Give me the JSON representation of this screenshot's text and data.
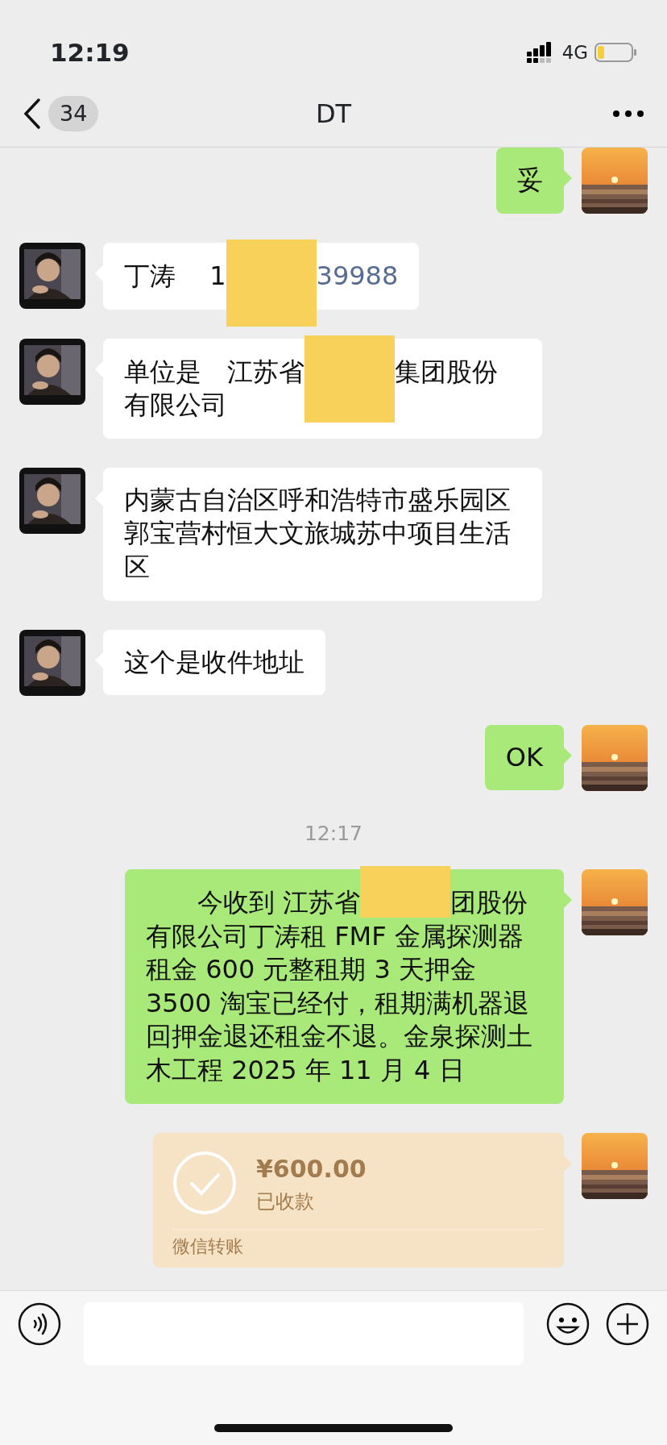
{
  "status_bar": {
    "time": "12:19",
    "network": "4G"
  },
  "nav": {
    "back_count": "34",
    "title": "DT"
  },
  "messages": [
    {
      "kind": "text",
      "outgoing": true,
      "segments": [
        {
          "kind": "plain",
          "text": "妥"
        }
      ]
    },
    {
      "kind": "text",
      "outgoing": false,
      "segments": [
        {
          "kind": "plain",
          "text": "丁涛　 1"
        },
        {
          "kind": "redacted"
        },
        {
          "kind": "link",
          "text": "39988"
        }
      ]
    },
    {
      "kind": "text",
      "outgoing": false,
      "segments": [
        {
          "kind": "plain",
          "text": "单位是　江苏省"
        },
        {
          "kind": "redacted"
        },
        {
          "kind": "plain",
          "text": "集团股份有限公司"
        }
      ]
    },
    {
      "kind": "text",
      "outgoing": false,
      "segments": [
        {
          "kind": "plain",
          "text": "内蒙古自治区呼和浩特市盛乐园区郭宝营村恒大文旅城苏中项目生活区"
        }
      ]
    },
    {
      "kind": "text",
      "outgoing": false,
      "segments": [
        {
          "kind": "plain",
          "text": "这个是收件地址"
        }
      ]
    },
    {
      "kind": "text",
      "outgoing": true,
      "segments": [
        {
          "kind": "plain",
          "text": "OK"
        }
      ]
    },
    {
      "kind": "time",
      "text": "12:17"
    },
    {
      "kind": "text",
      "outgoing": true,
      "segments": [
        {
          "kind": "plain",
          "text": "　　今收到 江苏省"
        },
        {
          "kind": "redacted"
        },
        {
          "kind": "plain",
          "text": "团股份有限公司丁涛租 FMF 金属探测器租金 600 元整租期 3 天押金 3500 淘宝已经付，租期满机器退回押金退还租金不退。金泉探测土木工程 2025 年 11 月 4 日"
        }
      ]
    },
    {
      "kind": "transfer",
      "outgoing": true,
      "received": true,
      "amount": "¥600.00",
      "status": "已收款",
      "footer": "微信转账"
    }
  ]
}
